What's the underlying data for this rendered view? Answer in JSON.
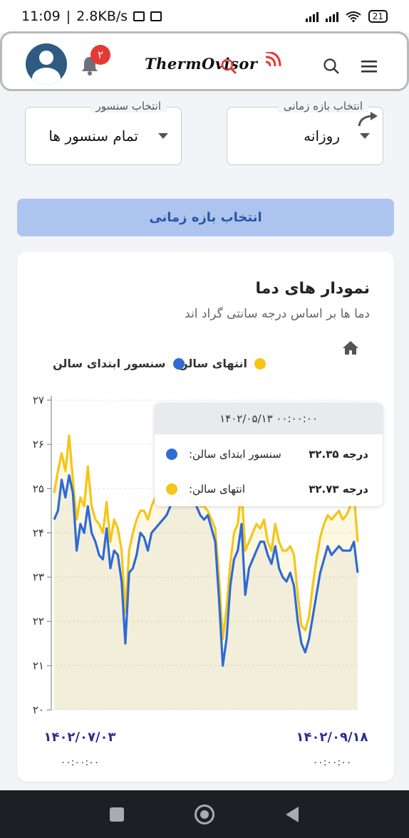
{
  "status_bar": {
    "time": "11:09",
    "net_speed": "2.8KB/s",
    "battery": "21"
  },
  "header": {
    "logo": "ThermOvisor",
    "notification_count": "۲"
  },
  "filters": {
    "range_label": "انتخاب بازه زمانی",
    "range_value": "روزانه",
    "sensor_label": "انتخاب سنسور",
    "sensor_value": "تمام سنسور ها"
  },
  "range_button": "انتخاب بازه زمانی",
  "card": {
    "title": "نمودار های دما",
    "subtitle": "دما ها بر اساس درجه سانتی گراد اند"
  },
  "tooltip": {
    "header": "۱۴۰۲/۰۵/۱۳ ۰۰:۰۰:۰۰",
    "rows": [
      {
        "name": "سنسور ابتدای سالن:",
        "value": "درجه ۳۲.۳۵",
        "color": "#2e6bd3"
      },
      {
        "name": "انتهای سالن:",
        "value": "درجه ۳۲.۷۳",
        "color": "#f5c518"
      }
    ]
  },
  "chart_data": {
    "type": "line",
    "yticks": [
      "۲۰",
      "۲۱",
      "۲۲",
      "۲۳",
      "۲۴",
      "۲۵",
      "۲۶",
      "۲۷"
    ],
    "ylim": [
      20,
      27
    ],
    "x_labels": [
      {
        "date": "۱۴۰۲/۰۷/۰۳",
        "time": "۰۰:۰۰:۰۰"
      },
      {
        "date": "۱۴۰۲/۰۹/۱۸",
        "time": "۰۰:۰۰:۰۰"
      }
    ],
    "series": [
      {
        "name": "سنسور ابتدای سالن",
        "color": "#2e6bd3",
        "values": [
          24.3,
          24.5,
          25.2,
          24.8,
          25.3,
          24.9,
          23.6,
          24.2,
          24.0,
          24.6,
          24.0,
          23.8,
          23.5,
          23.4,
          24.1,
          23.2,
          23.6,
          23.5,
          22.9,
          21.5,
          23.1,
          23.2,
          23.5,
          24.0,
          23.9,
          23.6,
          24.0,
          24.1,
          24.2,
          24.3,
          24.4,
          24.6,
          24.8,
          24.9,
          24.8,
          24.9,
          24.8,
          24.7,
          24.6,
          24.4,
          24.3,
          24.4,
          24.1,
          23.8,
          22.5,
          21.0,
          21.6,
          22.8,
          23.4,
          23.6,
          24.2,
          22.6,
          23.2,
          23.4,
          23.6,
          23.8,
          23.8,
          23.5,
          23.3,
          23.7,
          23.2,
          23.0,
          22.9,
          23.1,
          22.8,
          22.0,
          21.5,
          21.3,
          21.6,
          22.1,
          22.6,
          23.1,
          23.4,
          23.7,
          23.5,
          23.6,
          23.7,
          23.6,
          23.6,
          23.6,
          23.8,
          23.1
        ]
      },
      {
        "name": "انتهای سالن",
        "color": "#f5c518",
        "values": [
          24.9,
          25.4,
          25.8,
          25.4,
          26.2,
          25.2,
          24.3,
          24.8,
          24.6,
          25.5,
          24.6,
          24.3,
          24.2,
          24.0,
          24.7,
          23.8,
          24.3,
          24.1,
          23.6,
          22.2,
          23.6,
          24.0,
          24.3,
          24.5,
          24.5,
          24.3,
          24.6,
          24.8,
          25.0,
          25.1,
          25.1,
          25.2,
          25.1,
          25.1,
          25.0,
          25.0,
          24.9,
          24.9,
          24.7,
          24.6,
          24.6,
          24.5,
          24.3,
          24.1,
          23.0,
          21.6,
          22.3,
          23.3,
          24.0,
          24.2,
          25.0,
          23.6,
          23.8,
          24.0,
          24.2,
          24.1,
          24.3,
          23.8,
          23.6,
          24.2,
          23.8,
          23.6,
          23.6,
          23.7,
          23.5,
          22.6,
          21.9,
          21.8,
          22.1,
          22.8,
          23.4,
          23.9,
          24.2,
          24.4,
          24.3,
          24.4,
          24.5,
          24.3,
          24.4,
          24.6,
          24.9,
          23.8
        ]
      }
    ],
    "grid": true,
    "legend": "top"
  }
}
